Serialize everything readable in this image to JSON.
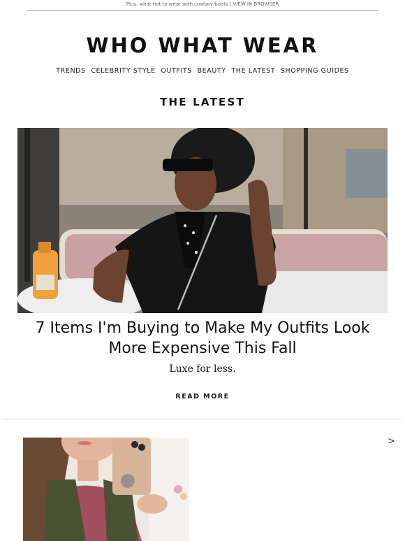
{
  "preheader": {
    "text": "Plus, what not to wear with cowboy boots |",
    "link": "VIEW IN BROWSER"
  },
  "brand": {
    "logo_text": "WHO WHAT WEAR"
  },
  "nav": {
    "items": [
      "TRENDS",
      "CELEBRITY STYLE",
      "OUTFITS",
      "BEAUTY",
      "THE LATEST",
      "SHOPPING GUIDES"
    ]
  },
  "section": {
    "title": "THE LATEST"
  },
  "feature": {
    "headline": "7 Items I'm Buying to Make My Outfits Look More Expensive This Fall",
    "dek": "Luxe for less.",
    "cta": "READ MORE"
  },
  "carousel": {
    "next_glyph": ">"
  },
  "colors": {
    "text": "#111111",
    "divider": "#dddddd",
    "hero_top": "#c8b9a6",
    "hero_bottom": "#5c5a57"
  }
}
